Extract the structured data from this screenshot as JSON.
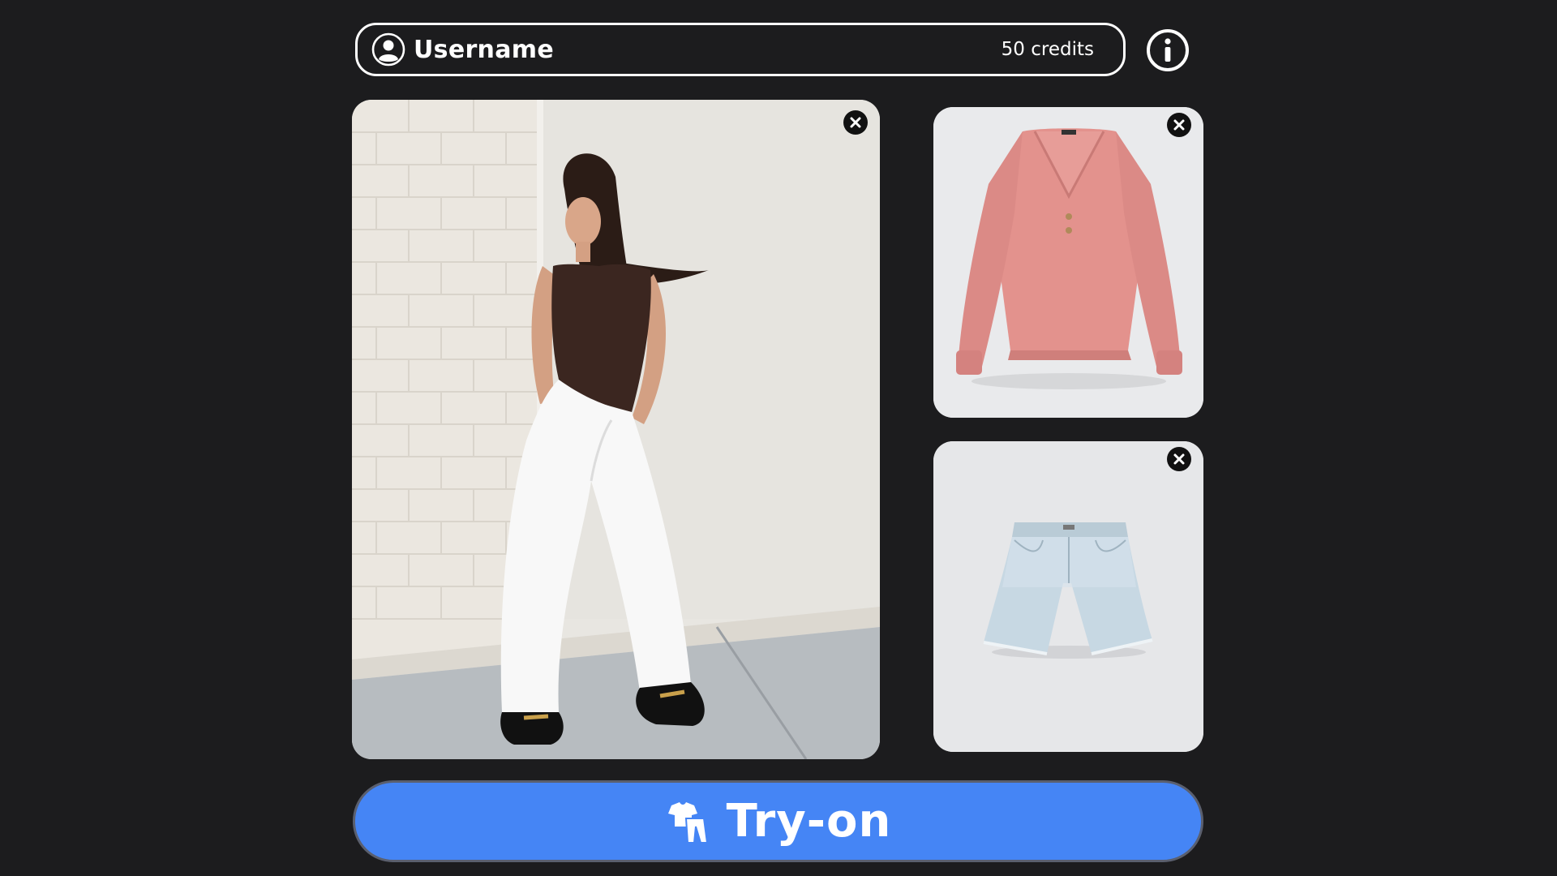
{
  "header": {
    "username": "Username",
    "credits": "50 credits"
  },
  "icons": {
    "avatar": "user-circle-icon",
    "info": "info-circle-icon",
    "remove": "close-icon",
    "tryon": "clothing-icon"
  },
  "images": {
    "model_photo": "model-photo",
    "top_garment": "pink-blouse",
    "bottom_garment": "denim-shorts"
  },
  "actions": {
    "tryon_label": "Try-on"
  },
  "colors": {
    "background": "#1c1c1e",
    "accent": "#4585f5",
    "text": "#ffffff"
  }
}
